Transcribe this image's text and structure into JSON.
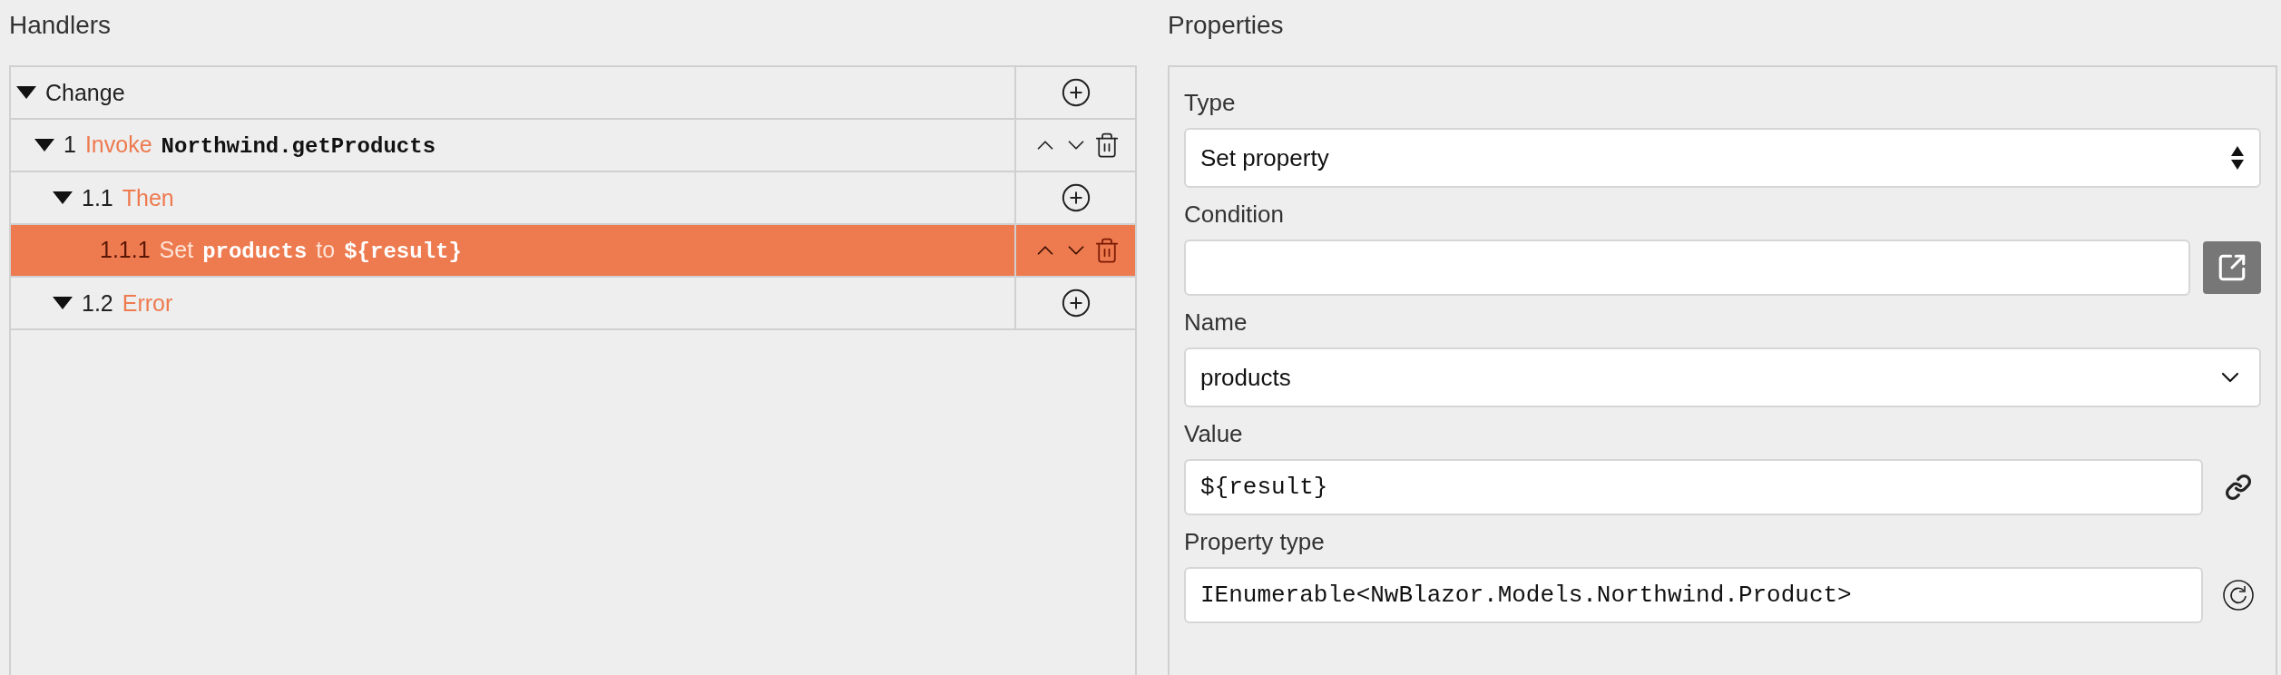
{
  "handlers": {
    "title": "Handlers",
    "tree": [
      {
        "expanded": true,
        "selected": false,
        "parts": [
          {
            "kind": "text",
            "text": "Change"
          }
        ],
        "actions": [
          {
            "kind": "add"
          }
        ],
        "children": [
          {
            "expanded": true,
            "selected": false,
            "parts": [
              {
                "kind": "text",
                "text": "1"
              },
              {
                "kind": "keyword",
                "text": "Invoke"
              },
              {
                "kind": "code",
                "text": "Northwind.getProducts"
              }
            ],
            "actions": [
              {
                "kind": "up"
              },
              {
                "kind": "down"
              },
              {
                "kind": "delete"
              }
            ],
            "children": [
              {
                "expanded": true,
                "selected": false,
                "parts": [
                  {
                    "kind": "text",
                    "text": "1.1"
                  },
                  {
                    "kind": "keyword",
                    "text": "Then"
                  }
                ],
                "actions": [
                  {
                    "kind": "add"
                  }
                ],
                "children": [
                  {
                    "selected": true,
                    "parts": [
                      {
                        "kind": "text",
                        "text": "1.1.1"
                      },
                      {
                        "kind": "keyword",
                        "text": "Set"
                      },
                      {
                        "kind": "code",
                        "text": "products"
                      },
                      {
                        "kind": "keyword",
                        "text": "to"
                      },
                      {
                        "kind": "code",
                        "text": "${result}"
                      }
                    ],
                    "actions": [
                      {
                        "kind": "up"
                      },
                      {
                        "kind": "down"
                      },
                      {
                        "kind": "delete"
                      }
                    ]
                  }
                ]
              },
              {
                "expanded": true,
                "selected": false,
                "parts": [
                  {
                    "kind": "text",
                    "text": "1.2"
                  },
                  {
                    "kind": "keyword",
                    "text": "Error"
                  }
                ],
                "actions": [
                  {
                    "kind": "add"
                  }
                ]
              }
            ]
          }
        ]
      }
    ]
  },
  "properties": {
    "title": "Properties",
    "fields": [
      {
        "label": "Type",
        "kind": "select",
        "value": "Set property"
      },
      {
        "label": "Condition",
        "kind": "text",
        "button": {
          "kind": "open"
        }
      },
      {
        "label": "Name",
        "kind": "combo",
        "value": "products"
      },
      {
        "label": "Value",
        "kind": "code",
        "value": "${result}",
        "button": {
          "kind": "link"
        }
      },
      {
        "label": "Property type",
        "kind": "code",
        "value": "IEnumerable<NwBlazor.Models.Northwind.Product>",
        "button": {
          "kind": "refresh"
        }
      }
    ]
  }
}
